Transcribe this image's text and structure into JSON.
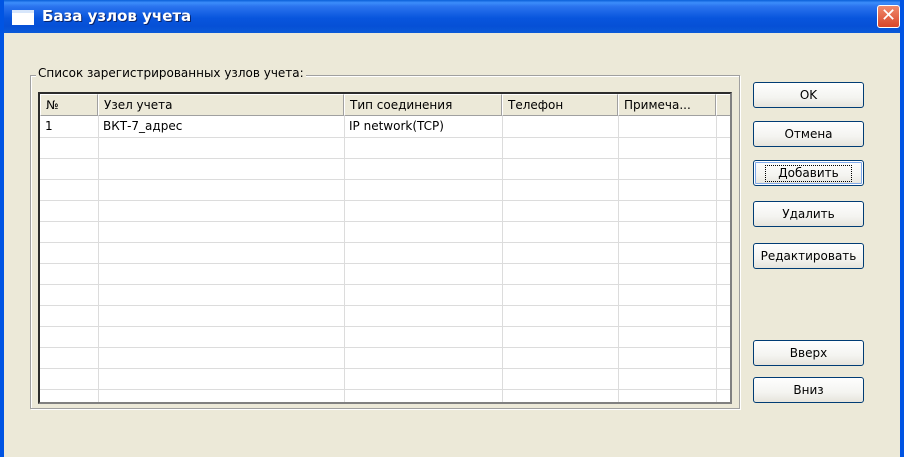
{
  "window": {
    "title": "База узлов учета",
    "close_glyph": "✕"
  },
  "group": {
    "label": "Список зарегистрированных узлов учета:"
  },
  "list": {
    "columns": [
      "№",
      "Узел учета",
      "Тип соединения",
      "Телефон",
      "Примеча..."
    ],
    "rows": [
      {
        "num": "1",
        "node": "ВКТ-7_адрес",
        "connection": "IP network(TCP)",
        "phone": "",
        "note": ""
      }
    ]
  },
  "buttons": {
    "ok": "OK",
    "cancel": "Отмена",
    "add": "Добавить",
    "delete": "Удалить",
    "edit": "Редактировать",
    "up": "Вверх",
    "down": "Вниз"
  }
}
